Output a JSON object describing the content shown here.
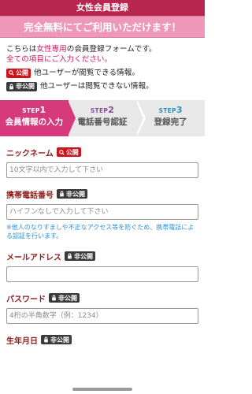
{
  "header": {
    "title": "女性会員登録"
  },
  "banner": {
    "text": "完全無料にてご利用いただけます！"
  },
  "intro": {
    "pre": "こちらは",
    "highlight": "女性専用",
    "post": "の会員登録フォームです。",
    "required_note": "全ての項目にご入力ください。",
    "legend_public_badge": "公開",
    "legend_public_text": "他ユーザーが閲覧できる情報。",
    "legend_private_badge": "非公開",
    "legend_private_text": "他ユーザーは閲覧できない情報。"
  },
  "steps": [
    {
      "prefix": "STEP",
      "num": "1",
      "label": "会員情報の入力",
      "active": true
    },
    {
      "prefix": "STEP",
      "num": "2",
      "label": "電話番号認証",
      "active": false
    },
    {
      "prefix": "STEP",
      "num": "3",
      "label": "登録完了",
      "active": false
    }
  ],
  "fields": {
    "nickname": {
      "label": "ニックネーム",
      "badge": "公開",
      "placeholder": "10文字以内で入力して下さい",
      "value": ""
    },
    "phone": {
      "label": "携帯電話番号",
      "badge": "非公開",
      "placeholder": "ハイフンなしで入力して下さい",
      "value": "",
      "note": "※他人のなりすましや不正なアクセス等を防ぐため、携帯電話による認証を行います。"
    },
    "email": {
      "label": "メールアドレス",
      "badge": "非公開",
      "placeholder": "",
      "value": ""
    },
    "password": {
      "label": "パスワード",
      "badge": "非公開",
      "placeholder": "4桁の半角数字（例：1234）",
      "value": ""
    },
    "birthday": {
      "label": "生年月日",
      "badge": "非公開"
    }
  },
  "icons": {
    "public": "search-icon",
    "private": "lock-icon"
  },
  "colors": {
    "header_bg": "#b8264f",
    "banner_bg": "#ee97b9",
    "accent": "#d4145a",
    "public_badge": "#d0121b",
    "private_badge": "#3a3a3a",
    "step_active": "#d63a7a",
    "note": "#2a8fd1"
  }
}
